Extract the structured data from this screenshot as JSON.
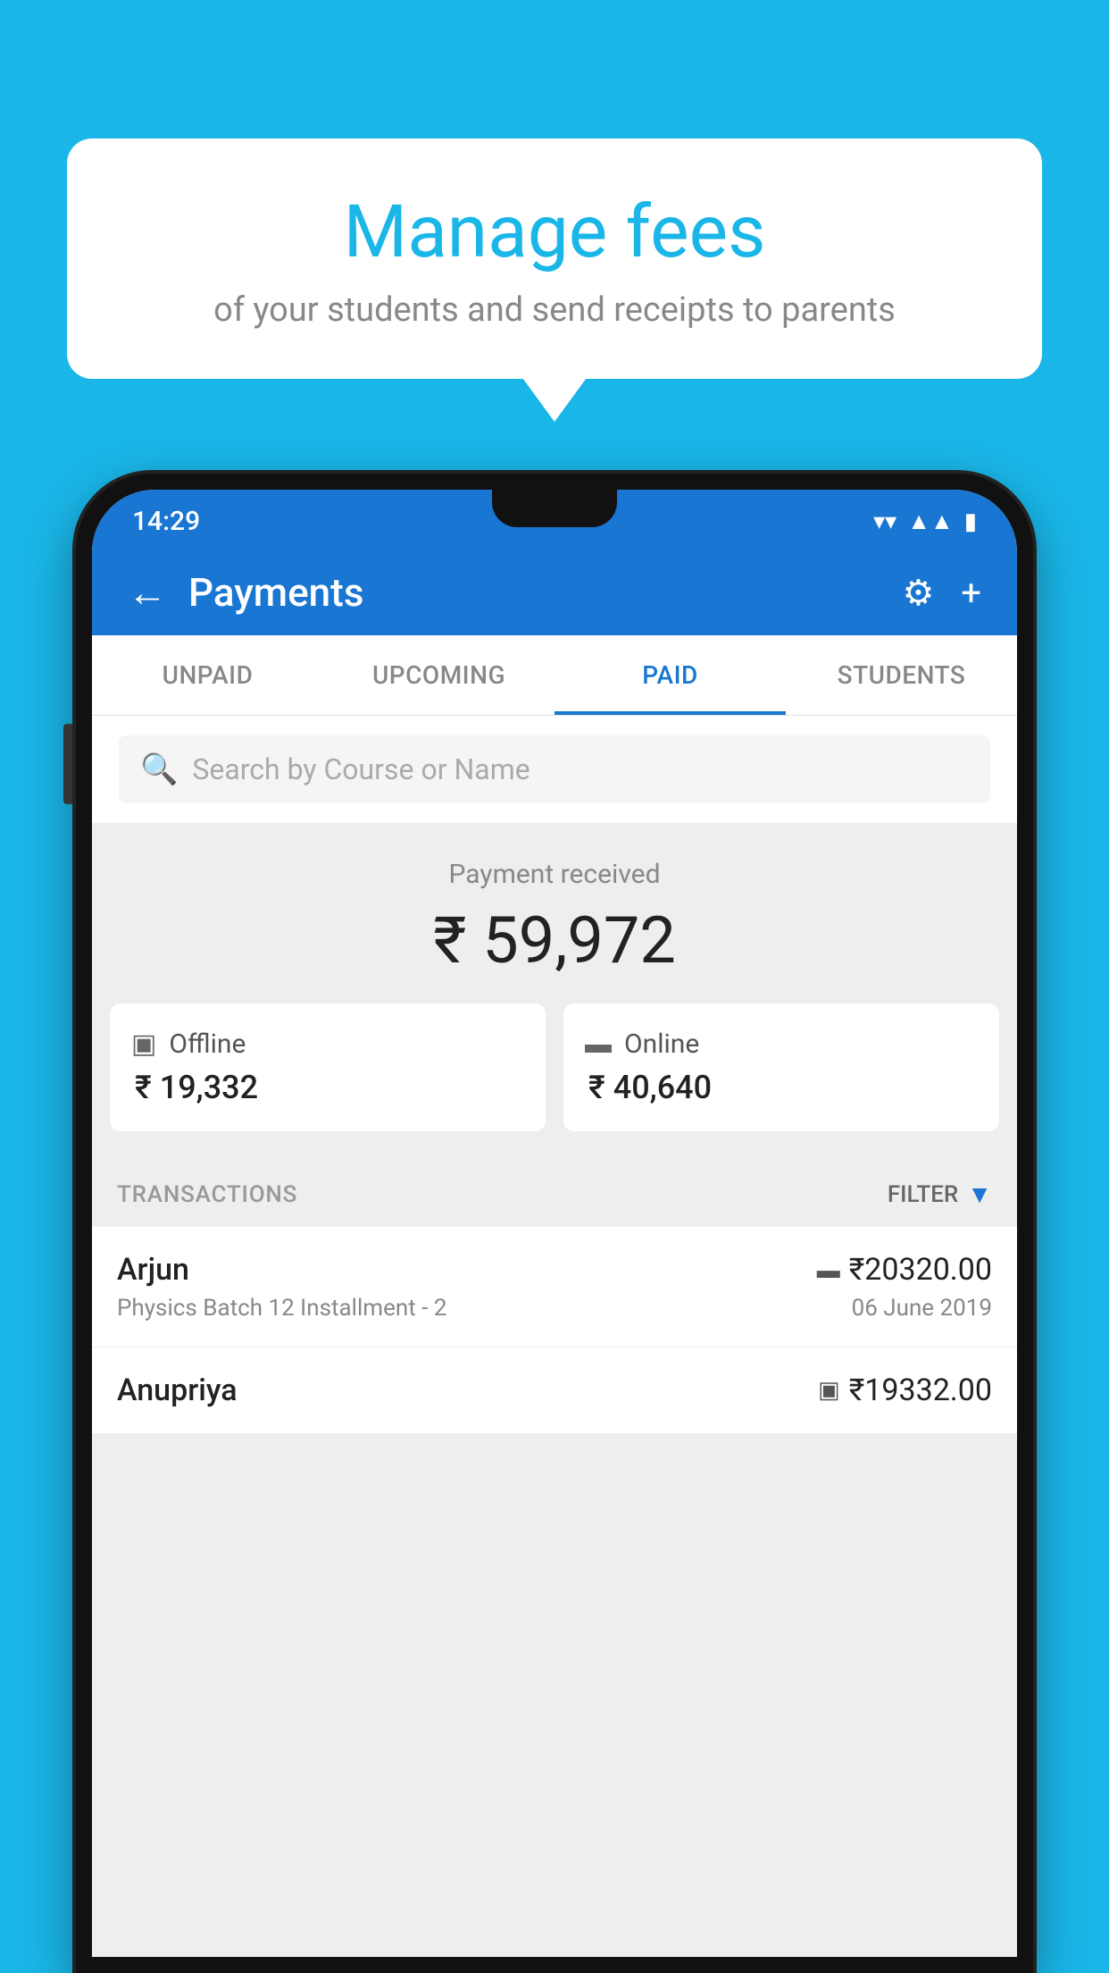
{
  "background_color": "#1ab6e8",
  "bubble": {
    "title": "Manage fees",
    "subtitle": "of your students and send receipts to parents"
  },
  "status_bar": {
    "time": "14:29",
    "wifi_icon": "▼",
    "signal_icon": "▲",
    "battery_icon": "▮"
  },
  "app_bar": {
    "title": "Payments",
    "back_label": "←",
    "settings_label": "⚙",
    "add_label": "+"
  },
  "tabs": [
    {
      "label": "UNPAID",
      "active": false
    },
    {
      "label": "UPCOMING",
      "active": false
    },
    {
      "label": "PAID",
      "active": true
    },
    {
      "label": "STUDENTS",
      "active": false
    }
  ],
  "search": {
    "placeholder": "Search by Course or Name"
  },
  "payment_summary": {
    "label": "Payment received",
    "amount": "₹ 59,972",
    "offline": {
      "type": "Offline",
      "amount": "₹ 19,332"
    },
    "online": {
      "type": "Online",
      "amount": "₹ 40,640"
    }
  },
  "transactions": {
    "label": "TRANSACTIONS",
    "filter_label": "FILTER",
    "items": [
      {
        "name": "Arjun",
        "amount": "₹20320.00",
        "course": "Physics Batch 12 Installment - 2",
        "date": "06 June 2019",
        "payment_type": "online"
      },
      {
        "name": "Anupriya",
        "amount": "₹19332.00",
        "course": "",
        "date": "",
        "payment_type": "offline"
      }
    ]
  }
}
